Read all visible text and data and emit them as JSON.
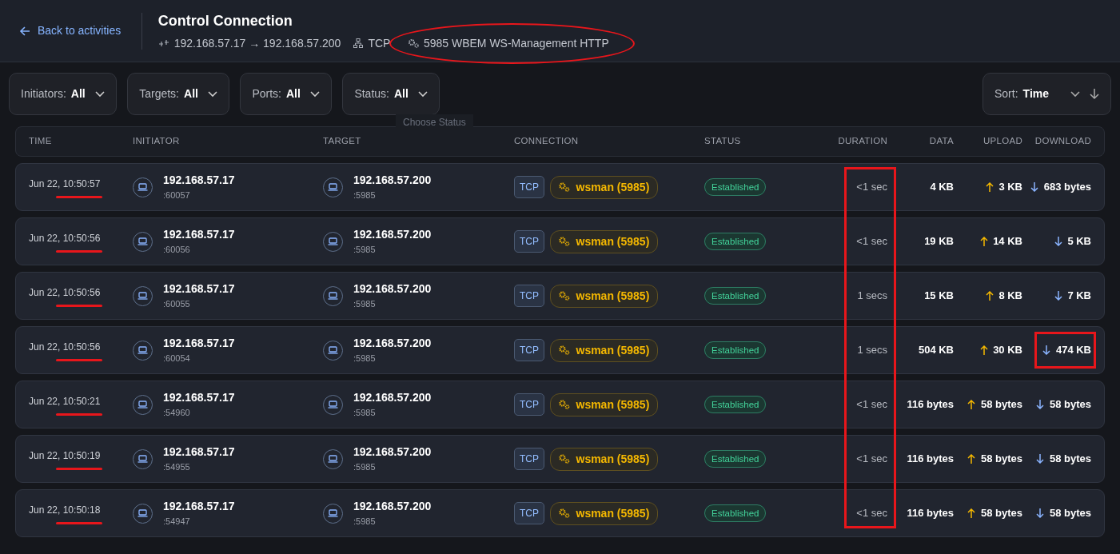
{
  "header": {
    "back_link": "Back to activities",
    "title": "Control Connection",
    "endpoints": "192.168.57.17 → 192.168.57.200",
    "protocol": "TCP",
    "service": "5985 WBEM WS-Management HTTP",
    "service_circled": true
  },
  "filters": [
    {
      "label": "Initiators:",
      "value": "All"
    },
    {
      "label": "Targets:",
      "value": "All"
    },
    {
      "label": "Ports:",
      "value": "All"
    },
    {
      "label": "Status:",
      "value": "All"
    }
  ],
  "tooltip": "Choose Status",
  "sort": {
    "label": "Sort:",
    "value": "Time"
  },
  "table": {
    "columns": [
      "TIME",
      "INITIATOR",
      "TARGET",
      "CONNECTION",
      "STATUS",
      "DURATION",
      "DATA",
      "UPLOAD",
      "DOWNLOAD"
    ],
    "duration_column_boxed": true,
    "rows": [
      {
        "time": "Jun 22, 10:50:57",
        "time_underlined": true,
        "initiator": "192.168.57.17",
        "initiator_port": ":60057",
        "target": "192.168.57.200",
        "target_port": ":5985",
        "protocol": "TCP",
        "service": "wsman (5985)",
        "status": "Established",
        "duration": "<1 sec",
        "data": "4 KB",
        "upload": "3 KB",
        "download": "683 bytes",
        "download_boxed": false
      },
      {
        "time": "Jun 22, 10:50:56",
        "time_underlined": true,
        "initiator": "192.168.57.17",
        "initiator_port": ":60056",
        "target": "192.168.57.200",
        "target_port": ":5985",
        "protocol": "TCP",
        "service": "wsman (5985)",
        "status": "Established",
        "duration": "<1 sec",
        "data": "19 KB",
        "upload": "14 KB",
        "download": "5 KB",
        "download_boxed": false
      },
      {
        "time": "Jun 22, 10:50:56",
        "time_underlined": true,
        "initiator": "192.168.57.17",
        "initiator_port": ":60055",
        "target": "192.168.57.200",
        "target_port": ":5985",
        "protocol": "TCP",
        "service": "wsman (5985)",
        "status": "Established",
        "duration": "1 secs",
        "data": "15 KB",
        "upload": "8 KB",
        "download": "7 KB",
        "download_boxed": false
      },
      {
        "time": "Jun 22, 10:50:56",
        "time_underlined": true,
        "initiator": "192.168.57.17",
        "initiator_port": ":60054",
        "target": "192.168.57.200",
        "target_port": ":5985",
        "protocol": "TCP",
        "service": "wsman (5985)",
        "status": "Established",
        "duration": "1 secs",
        "data": "504 KB",
        "upload": "30 KB",
        "download": "474 KB",
        "download_boxed": true
      },
      {
        "time": "Jun 22, 10:50:21",
        "time_underlined": true,
        "initiator": "192.168.57.17",
        "initiator_port": ":54960",
        "target": "192.168.57.200",
        "target_port": ":5985",
        "protocol": "TCP",
        "service": "wsman (5985)",
        "status": "Established",
        "duration": "<1 sec",
        "data": "116 bytes",
        "upload": "58 bytes",
        "download": "58 bytes",
        "download_boxed": false
      },
      {
        "time": "Jun 22, 10:50:19",
        "time_underlined": true,
        "initiator": "192.168.57.17",
        "initiator_port": ":54955",
        "target": "192.168.57.200",
        "target_port": ":5985",
        "protocol": "TCP",
        "service": "wsman (5985)",
        "status": "Established",
        "duration": "<1 sec",
        "data": "116 bytes",
        "upload": "58 bytes",
        "download": "58 bytes",
        "download_boxed": false
      },
      {
        "time": "Jun 22, 10:50:18",
        "time_underlined": true,
        "initiator": "192.168.57.17",
        "initiator_port": ":54947",
        "target": "192.168.57.200",
        "target_port": ":5985",
        "protocol": "TCP",
        "service": "wsman (5985)",
        "status": "Established",
        "duration": "<1 sec",
        "data": "116 bytes",
        "upload": "58 bytes",
        "download": "58 bytes",
        "download_boxed": false
      }
    ]
  }
}
